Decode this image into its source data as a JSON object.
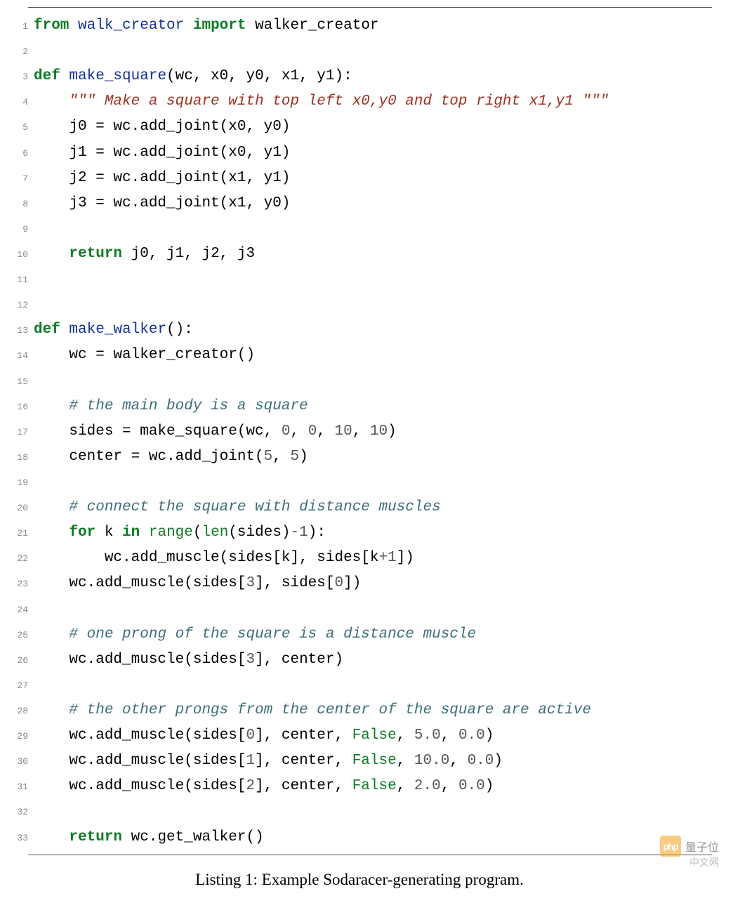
{
  "caption": "Listing 1: Example Sodaracer-generating program.",
  "watermark": {
    "logo_text": "php",
    "label": "量子位",
    "sub": "中文网"
  },
  "code": {
    "lines": [
      {
        "n": 1,
        "tokens": [
          {
            "c": "kw",
            "t": "from"
          },
          {
            "c": "txt",
            "t": " "
          },
          {
            "c": "fn",
            "t": "walk_creator"
          },
          {
            "c": "txt",
            "t": " "
          },
          {
            "c": "kw",
            "t": "import"
          },
          {
            "c": "txt",
            "t": " "
          },
          {
            "c": "txt",
            "t": "walker_creator"
          }
        ]
      },
      {
        "n": 2,
        "tokens": []
      },
      {
        "n": 3,
        "tokens": [
          {
            "c": "kw",
            "t": "def"
          },
          {
            "c": "txt",
            "t": " "
          },
          {
            "c": "fn",
            "t": "make_square"
          },
          {
            "c": "txt",
            "t": "(wc, x0, y0, x1, y1):"
          }
        ]
      },
      {
        "n": 4,
        "tokens": [
          {
            "c": "txt",
            "t": "    "
          },
          {
            "c": "str",
            "t": "\"\"\" Make a square with top left x0,y0 and top right x1,y1 \"\"\""
          }
        ]
      },
      {
        "n": 5,
        "tokens": [
          {
            "c": "txt",
            "t": "    j0 = wc.add_joint(x0, y0)"
          }
        ]
      },
      {
        "n": 6,
        "tokens": [
          {
            "c": "txt",
            "t": "    j1 = wc.add_joint(x0, y1)"
          }
        ]
      },
      {
        "n": 7,
        "tokens": [
          {
            "c": "txt",
            "t": "    j2 = wc.add_joint(x1, y1)"
          }
        ]
      },
      {
        "n": 8,
        "tokens": [
          {
            "c": "txt",
            "t": "    j3 = wc.add_joint(x1, y0)"
          }
        ]
      },
      {
        "n": 9,
        "tokens": []
      },
      {
        "n": 10,
        "tokens": [
          {
            "c": "txt",
            "t": "    "
          },
          {
            "c": "kw",
            "t": "return"
          },
          {
            "c": "txt",
            "t": " j0, j1, j2, j3"
          }
        ]
      },
      {
        "n": 11,
        "tokens": []
      },
      {
        "n": 12,
        "tokens": []
      },
      {
        "n": 13,
        "tokens": [
          {
            "c": "kw",
            "t": "def"
          },
          {
            "c": "txt",
            "t": " "
          },
          {
            "c": "fn",
            "t": "make_walker"
          },
          {
            "c": "txt",
            "t": "():"
          }
        ]
      },
      {
        "n": 14,
        "tokens": [
          {
            "c": "txt",
            "t": "    wc = walker_creator()"
          }
        ]
      },
      {
        "n": 15,
        "tokens": []
      },
      {
        "n": 16,
        "tokens": [
          {
            "c": "txt",
            "t": "    "
          },
          {
            "c": "cmt",
            "t": "# the main body is a square"
          }
        ]
      },
      {
        "n": 17,
        "tokens": [
          {
            "c": "txt",
            "t": "    sides = make_square(wc, "
          },
          {
            "c": "num",
            "t": "0"
          },
          {
            "c": "txt",
            "t": ", "
          },
          {
            "c": "num",
            "t": "0"
          },
          {
            "c": "txt",
            "t": ", "
          },
          {
            "c": "num",
            "t": "10"
          },
          {
            "c": "txt",
            "t": ", "
          },
          {
            "c": "num",
            "t": "10"
          },
          {
            "c": "txt",
            "t": ")"
          }
        ]
      },
      {
        "n": 18,
        "tokens": [
          {
            "c": "txt",
            "t": "    center = wc.add_joint("
          },
          {
            "c": "num",
            "t": "5"
          },
          {
            "c": "txt",
            "t": ", "
          },
          {
            "c": "num",
            "t": "5"
          },
          {
            "c": "txt",
            "t": ")"
          }
        ]
      },
      {
        "n": 19,
        "tokens": []
      },
      {
        "n": 20,
        "tokens": [
          {
            "c": "txt",
            "t": "    "
          },
          {
            "c": "cmt",
            "t": "# connect the square with distance muscles"
          }
        ]
      },
      {
        "n": 21,
        "tokens": [
          {
            "c": "txt",
            "t": "    "
          },
          {
            "c": "kw",
            "t": "for"
          },
          {
            "c": "txt",
            "t": " k "
          },
          {
            "c": "kw",
            "t": "in"
          },
          {
            "c": "txt",
            "t": " "
          },
          {
            "c": "builtin",
            "t": "range"
          },
          {
            "c": "txt",
            "t": "("
          },
          {
            "c": "builtin",
            "t": "len"
          },
          {
            "c": "txt",
            "t": "(sides)"
          },
          {
            "c": "num",
            "t": "-1"
          },
          {
            "c": "txt",
            "t": "):"
          }
        ]
      },
      {
        "n": 22,
        "tokens": [
          {
            "c": "txt",
            "t": "        wc.add_muscle(sides[k], sides[k"
          },
          {
            "c": "num",
            "t": "+1"
          },
          {
            "c": "txt",
            "t": "])"
          }
        ]
      },
      {
        "n": 23,
        "tokens": [
          {
            "c": "txt",
            "t": "    wc.add_muscle(sides["
          },
          {
            "c": "num",
            "t": "3"
          },
          {
            "c": "txt",
            "t": "], sides["
          },
          {
            "c": "num",
            "t": "0"
          },
          {
            "c": "txt",
            "t": "])"
          }
        ]
      },
      {
        "n": 24,
        "tokens": []
      },
      {
        "n": 25,
        "tokens": [
          {
            "c": "txt",
            "t": "    "
          },
          {
            "c": "cmt",
            "t": "# one prong of the square is a distance muscle"
          }
        ]
      },
      {
        "n": 26,
        "tokens": [
          {
            "c": "txt",
            "t": "    wc.add_muscle(sides["
          },
          {
            "c": "num",
            "t": "3"
          },
          {
            "c": "txt",
            "t": "], center)"
          }
        ]
      },
      {
        "n": 27,
        "tokens": []
      },
      {
        "n": 28,
        "tokens": [
          {
            "c": "txt",
            "t": "    "
          },
          {
            "c": "cmt",
            "t": "# the other prongs from the center of the square are active"
          }
        ]
      },
      {
        "n": 29,
        "tokens": [
          {
            "c": "txt",
            "t": "    wc.add_muscle(sides["
          },
          {
            "c": "num",
            "t": "0"
          },
          {
            "c": "txt",
            "t": "], center, "
          },
          {
            "c": "builtin",
            "t": "False"
          },
          {
            "c": "txt",
            "t": ", "
          },
          {
            "c": "num",
            "t": "5.0"
          },
          {
            "c": "txt",
            "t": ", "
          },
          {
            "c": "num",
            "t": "0.0"
          },
          {
            "c": "txt",
            "t": ")"
          }
        ]
      },
      {
        "n": 30,
        "tokens": [
          {
            "c": "txt",
            "t": "    wc.add_muscle(sides["
          },
          {
            "c": "num",
            "t": "1"
          },
          {
            "c": "txt",
            "t": "], center, "
          },
          {
            "c": "builtin",
            "t": "False"
          },
          {
            "c": "txt",
            "t": ", "
          },
          {
            "c": "num",
            "t": "10.0"
          },
          {
            "c": "txt",
            "t": ", "
          },
          {
            "c": "num",
            "t": "0.0"
          },
          {
            "c": "txt",
            "t": ")"
          }
        ]
      },
      {
        "n": 31,
        "tokens": [
          {
            "c": "txt",
            "t": "    wc.add_muscle(sides["
          },
          {
            "c": "num",
            "t": "2"
          },
          {
            "c": "txt",
            "t": "], center, "
          },
          {
            "c": "builtin",
            "t": "False"
          },
          {
            "c": "txt",
            "t": ", "
          },
          {
            "c": "num",
            "t": "2.0"
          },
          {
            "c": "txt",
            "t": ", "
          },
          {
            "c": "num",
            "t": "0.0"
          },
          {
            "c": "txt",
            "t": ")"
          }
        ]
      },
      {
        "n": 32,
        "tokens": []
      },
      {
        "n": 33,
        "tokens": [
          {
            "c": "txt",
            "t": "    "
          },
          {
            "c": "kw",
            "t": "return"
          },
          {
            "c": "txt",
            "t": " wc.get_walker()"
          }
        ]
      }
    ]
  }
}
